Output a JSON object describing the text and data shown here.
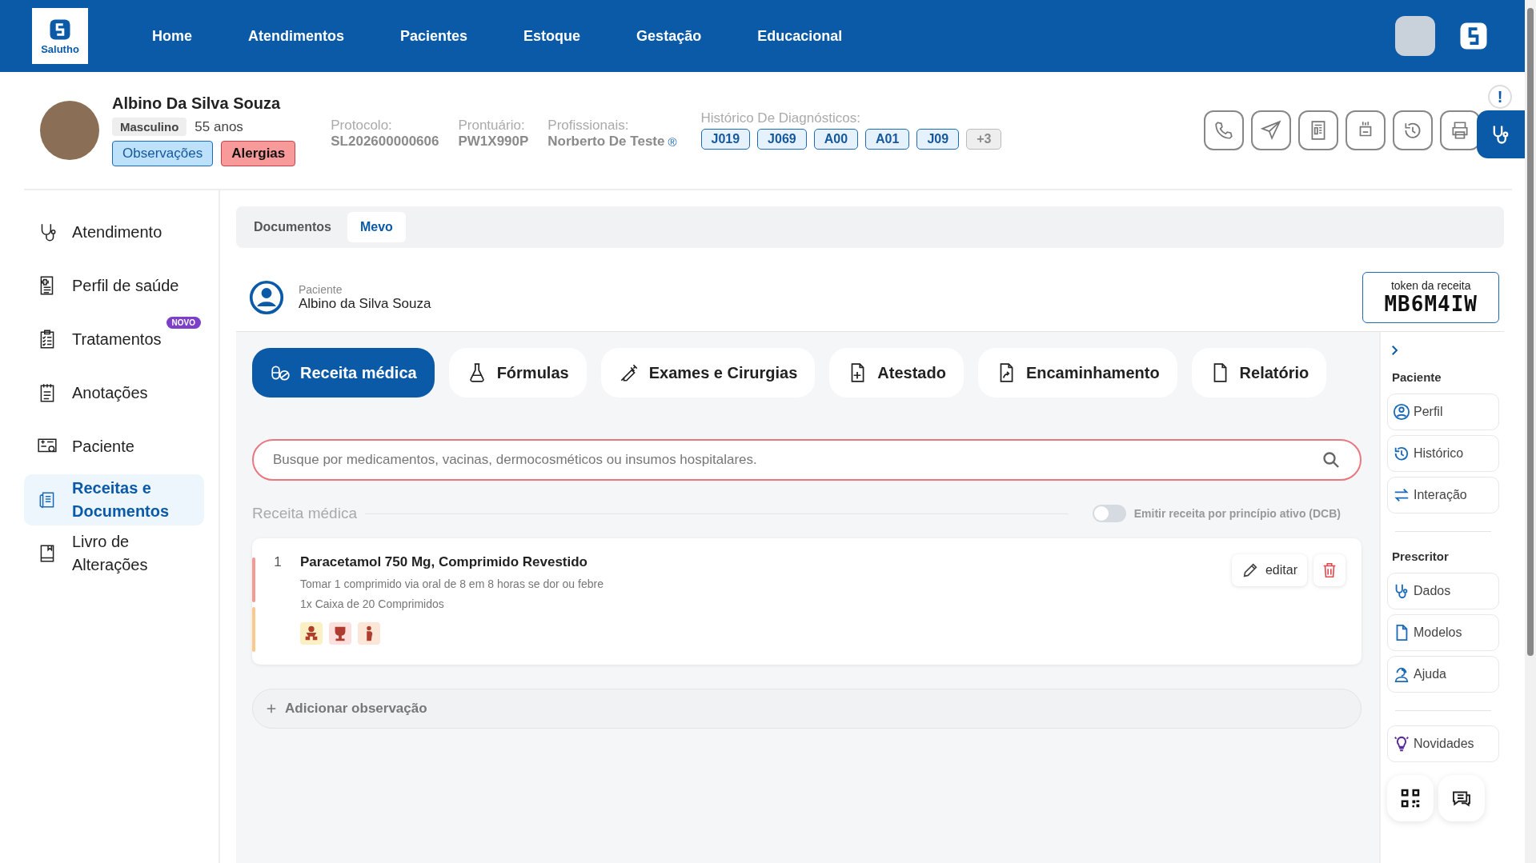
{
  "header": {
    "logo_text": "Salutho",
    "nav": [
      "Home",
      "Atendimentos",
      "Pacientes",
      "Estoque",
      "Gestação",
      "Educacional"
    ]
  },
  "patient": {
    "name": "Albino Da Silva Souza",
    "gender": "Masculino",
    "age": "55 anos",
    "buttons": [
      {
        "label": "Observações",
        "kind": "info"
      },
      {
        "label": "Alergias",
        "kind": "alert"
      }
    ],
    "fields": [
      {
        "label": "Protocolo:",
        "value": "SL202600000606"
      },
      {
        "label": "Prontuário:",
        "value": "PW1X990P"
      },
      {
        "label": "Profissionais:",
        "value": "Norberto De Teste",
        "mark": "®"
      }
    ],
    "diagnostics": {
      "label": "Histórico De Diagnósticos:",
      "codes": [
        {
          "code": "J019",
          "kind": "code"
        },
        {
          "code": "J069",
          "kind": "code"
        },
        {
          "code": "A00",
          "kind": "code"
        },
        {
          "code": "A01",
          "kind": "code"
        },
        {
          "code": "J09",
          "kind": "code"
        },
        {
          "code": "+3",
          "kind": "more"
        }
      ]
    },
    "alert_badge": "!"
  },
  "sidebar": {
    "items": [
      {
        "label": "Atendimento",
        "selected": false
      },
      {
        "label": "Perfil de saúde",
        "selected": false
      },
      {
        "label": "Tratamentos",
        "selected": false,
        "badge": "NOVO"
      },
      {
        "label": "Anotações",
        "selected": false
      },
      {
        "label": "Paciente",
        "selected": false
      },
      {
        "label": "Receitas e Documentos",
        "selected": true
      },
      {
        "label": "Livro de Alterações",
        "selected": false
      }
    ]
  },
  "tabs": [
    {
      "label": "Documentos",
      "selected": false
    },
    {
      "label": "Mevo",
      "selected": true
    }
  ],
  "patient_card": {
    "label": "Paciente",
    "name": "Albino da Silva Souza"
  },
  "token": {
    "label": "token da receita",
    "value": "MB6M4IW"
  },
  "doc_types": [
    {
      "label": "Receita médica",
      "selected": true
    },
    {
      "label": "Fórmulas",
      "selected": false
    },
    {
      "label": "Exames e Cirurgias",
      "selected": false
    },
    {
      "label": "Atestado",
      "selected": false
    },
    {
      "label": "Encaminhamento",
      "selected": false
    },
    {
      "label": "Relatório",
      "selected": false
    }
  ],
  "search": {
    "placeholder": "Busque por medicamentos, vacinas, dermocosméticos ou insumos hospitalares."
  },
  "prescription": {
    "title": "Receita médica",
    "toggle": {
      "label": "Emitir receita por princípio ativo (DCB)",
      "on": false
    },
    "items": [
      {
        "number": "1",
        "name": "Paracetamol 750 Mg, Comprimido Revestido",
        "instructions": "Tomar 1 comprimido via oral de 8 em 8 horas se dor ou febre",
        "quantity": "1x Caixa de 20 Comprimidos",
        "edit_label": "editar",
        "warnings": [
          {
            "kind": "child",
            "color": "#fbefc4"
          },
          {
            "kind": "alcohol",
            "color": "#fbe0de"
          },
          {
            "kind": "pregnancy",
            "color": "#fbe6d8"
          }
        ]
      }
    ],
    "add_observation": "Adicionar observação"
  },
  "right_panel": {
    "sections": [
      {
        "title": "Paciente",
        "items": [
          "Perfil",
          "Histórico",
          "Interação"
        ]
      },
      {
        "title": "Prescritor",
        "items": [
          "Dados",
          "Modelos",
          "Ajuda"
        ]
      },
      {
        "items": [
          "Novidades"
        ]
      }
    ]
  }
}
